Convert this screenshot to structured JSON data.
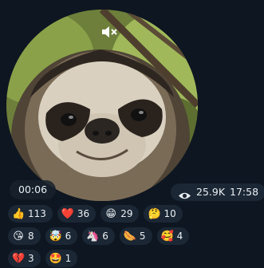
{
  "video": {
    "duration": "00:06",
    "views": "25.9K",
    "time": "17:58",
    "muted": true
  },
  "reactions": [
    {
      "emoji": "👍",
      "count": "113"
    },
    {
      "emoji": "❤️",
      "count": "36"
    },
    {
      "emoji": "😁",
      "count": "29"
    },
    {
      "emoji": "🤔",
      "count": "10"
    },
    {
      "emoji": "😘",
      "count": "8"
    },
    {
      "emoji": "🤯",
      "count": "6"
    },
    {
      "emoji": "🦄",
      "count": "6"
    },
    {
      "emoji": "🌭",
      "count": "5"
    },
    {
      "emoji": "🥰",
      "count": "4"
    },
    {
      "emoji": "💔",
      "count": "3"
    },
    {
      "emoji": "🤩",
      "count": "1"
    }
  ],
  "colors": {
    "background": "#0e1621",
    "pill": "#1b2734",
    "text": "#e9eef3"
  }
}
